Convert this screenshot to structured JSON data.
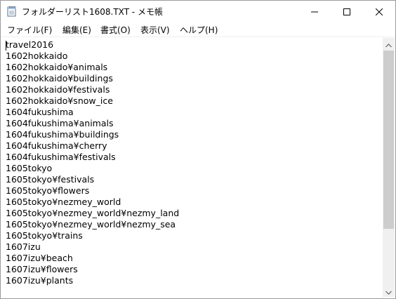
{
  "window": {
    "title": "フォルダーリスト1608.TXT - メモ帳",
    "icon": "notepad-icon"
  },
  "controls": {
    "minimize_icon": "minimize-icon",
    "maximize_icon": "maximize-icon",
    "close_icon": "close-icon"
  },
  "menu": {
    "file": "ファイル(F)",
    "edit": "編集(E)",
    "format": "書式(O)",
    "view": "表示(V)",
    "help": "ヘルプ(H)"
  },
  "editor": {
    "lines": [
      "travel2016",
      "1602hokkaido",
      "1602hokkaido¥animals",
      "1602hokkaido¥buildings",
      "1602hokkaido¥festivals",
      "1602hokkaido¥snow_ice",
      "1604fukushima",
      "1604fukushima¥animals",
      "1604fukushima¥buildings",
      "1604fukushima¥cherry",
      "1604fukushima¥festivals",
      "1605tokyo",
      "1605tokyo¥festivals",
      "1605tokyo¥flowers",
      "1605tokyo¥nezmey_world",
      "1605tokyo¥nezmey_world¥nezmy_land",
      "1605tokyo¥nezmey_world¥nezmy_sea",
      "1605tokyo¥trains",
      "1607izu",
      "1607izu¥beach",
      "1607izu¥flowers",
      "1607izu¥plants"
    ]
  },
  "scrollbar": {
    "up_icon": "scroll-up-arrow-icon",
    "down_icon": "scroll-down-arrow-icon"
  },
  "colors": {
    "thumb": "#cdcdcd",
    "track": "#f0f0f0",
    "border": "#9a9a9a"
  }
}
